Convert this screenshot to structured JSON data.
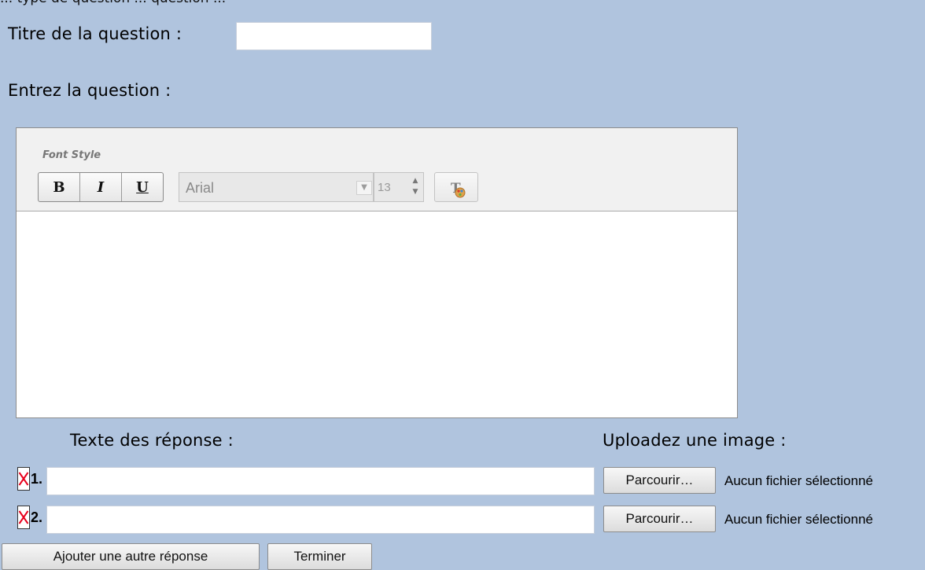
{
  "top_clipped_text": "... type de question ... question ...",
  "form": {
    "title_label": "Titre de la question :",
    "title_value": "",
    "question_label": "Entrez la question :"
  },
  "editor": {
    "font_style_label": "Font Style",
    "bold": "B",
    "italic": "I",
    "underline": "U",
    "font_family": "Arial",
    "font_size": "13",
    "content": ""
  },
  "answers": {
    "header_label": "Texte des réponse :",
    "upload_label": "Uploadez une image :",
    "items": [
      {
        "number": "1.",
        "value": "",
        "browse_label": "Parcourir…",
        "file_status": "Aucun fichier sélectionné"
      },
      {
        "number": "2.",
        "value": "",
        "browse_label": "Parcourir…",
        "file_status": "Aucun fichier sélectionné"
      }
    ]
  },
  "actions": {
    "add_answer": "Ajouter une autre réponse",
    "finish": "Terminer"
  },
  "colors": {
    "background": "#b0c4de",
    "remove_icon": "#e8001c"
  }
}
